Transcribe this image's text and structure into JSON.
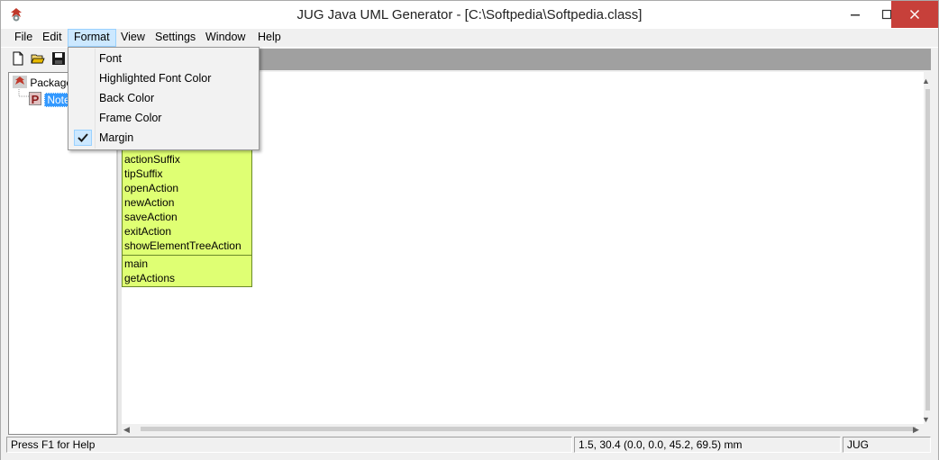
{
  "window": {
    "title": "JUG Java UML Generator - [C:\\Softpedia\\Softpedia.class]"
  },
  "menubar": {
    "items": [
      {
        "label": "File"
      },
      {
        "label": "Edit"
      },
      {
        "label": "Format"
      },
      {
        "label": "View"
      },
      {
        "label": "Settings"
      },
      {
        "label": "Window"
      },
      {
        "label": "Help"
      }
    ],
    "open_menu": "Format"
  },
  "format_menu": {
    "items": [
      {
        "label": "Font",
        "checked": false
      },
      {
        "label": "Highlighted Font Color",
        "checked": false
      },
      {
        "label": "Back Color",
        "checked": false
      },
      {
        "label": "Frame Color",
        "checked": false
      },
      {
        "label": "Margin",
        "checked": true
      }
    ]
  },
  "toolbar": {
    "icons": [
      "new-file-icon",
      "open-folder-icon",
      "save-disk-icon"
    ]
  },
  "tree": {
    "root_label": "Package",
    "child_badge": "P",
    "child_label": "Note"
  },
  "uml_class": {
    "attributes": [
      "actionSuffix",
      "tipSuffix",
      "openAction",
      "newAction",
      "saveAction",
      "exitAction",
      "showElementTreeAction"
    ],
    "methods": [
      "main",
      "getActions"
    ],
    "fill_color": "#dfff73"
  },
  "statusbar": {
    "help_text": "Press F1 for Help",
    "coords_text": "1.5, 30.4 (0.0, 0.0, 45.2, 69.5) mm",
    "mode_text": "JUG"
  },
  "colors": {
    "close_button": "#c7403a",
    "selection": "#3399ff",
    "menu_highlight": "#cce8ff"
  }
}
